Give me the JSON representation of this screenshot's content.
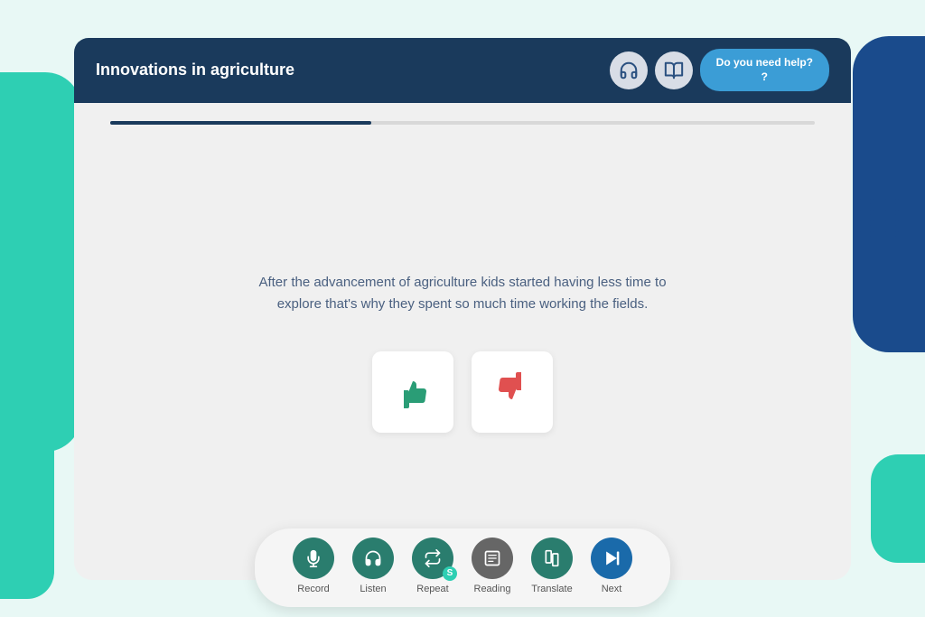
{
  "header": {
    "title": "Innovations in agriculture",
    "help_label": "Do you need help?\n?",
    "help_line1": "Do you need help?",
    "help_line2": "?"
  },
  "progress": {
    "fill_percent": "37%"
  },
  "content": {
    "question_text": "After the advancement of agriculture kids started having less time to explore that's why they spent so much time working the fields."
  },
  "answer_options": [
    {
      "id": "thumbs-up",
      "label": "True",
      "icon": "👍"
    },
    {
      "id": "thumbs-down",
      "label": "False",
      "icon": "👎"
    }
  ],
  "toolbar": {
    "items": [
      {
        "id": "record",
        "label": "Record",
        "icon": "🎤",
        "style": "teal"
      },
      {
        "id": "listen",
        "label": "Listen",
        "icon": "📡",
        "style": "teal"
      },
      {
        "id": "repeat",
        "label": "Repeat",
        "icon": "🔄",
        "style": "teal"
      },
      {
        "id": "reading",
        "label": "Reading",
        "icon": "📄",
        "style": "gray"
      },
      {
        "id": "translate",
        "label": "Translate",
        "icon": "✂",
        "style": "teal"
      },
      {
        "id": "next",
        "label": "Next",
        "icon": "⏭",
        "style": "blue"
      }
    ]
  }
}
